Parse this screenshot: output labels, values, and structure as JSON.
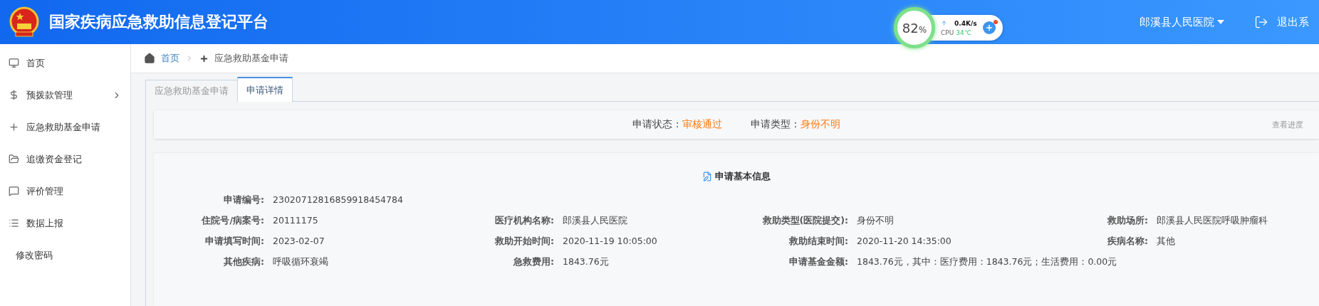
{
  "header": {
    "title": "国家疾病应急救助信息登记平台",
    "user": "郎溪县人民医院",
    "logout": "退出系"
  },
  "monitor_widget": {
    "percent": "82",
    "percent_unit": "%",
    "speed": "0.4K/s",
    "cpu_label": "CPU",
    "cpu_temp": "34℃"
  },
  "sidebar": {
    "items": [
      {
        "label": "首页",
        "expandable": false
      },
      {
        "label": "预拨款管理",
        "expandable": true
      },
      {
        "label": "应急救助基金申请",
        "expandable": false
      },
      {
        "label": "追缴资金登记",
        "expandable": false
      },
      {
        "label": "评价管理",
        "expandable": false
      },
      {
        "label": "数据上报",
        "expandable": false
      },
      {
        "label": "修改密码",
        "expandable": false
      }
    ]
  },
  "breadcrumb": {
    "home": "首页",
    "current": "应急救助基金申请"
  },
  "tabs": [
    {
      "label": "应急救助基金申请",
      "selected": false
    },
    {
      "label": "申请详情",
      "selected": true
    }
  ],
  "status_bar": {
    "status_label": "申请状态 : ",
    "status": "审核通过",
    "type_label": "申请类型 : ",
    "type": "身份不明",
    "link": "查看进度"
  },
  "info": {
    "title": "申请基本信息",
    "rows": [
      [
        {
          "label": "申请编号:",
          "value": "23020712816859918454784"
        }
      ],
      [
        {
          "label": "住院号/病案号:",
          "value": "20111175"
        },
        {
          "label": "医疗机构名称:",
          "value": "郎溪县人民医院"
        },
        {
          "label": "救助类型(医院提交):",
          "value": "身份不明"
        },
        {
          "label": "救助场所:",
          "value": "郎溪县人民医院呼吸肿瘤科"
        }
      ],
      [
        {
          "label": "申请填写时间:",
          "value": "2023-02-07"
        },
        {
          "label": "救助开始时间:",
          "value": "2020-11-19 10:05:00"
        },
        {
          "label": "救助结束时间:",
          "value": "2020-11-20 14:35:00"
        },
        {
          "label": "疾病名称:",
          "value": "其他"
        }
      ],
      [
        {
          "label": "其他疾病:",
          "value": "呼吸循环衰竭"
        },
        {
          "label": "急救费用:",
          "value": "1843.76元"
        },
        {
          "label": "申请基金金额:",
          "value": "1843.76元，其中：医疗费用：1843.76元；生活费用：0.00元"
        }
      ]
    ]
  }
}
